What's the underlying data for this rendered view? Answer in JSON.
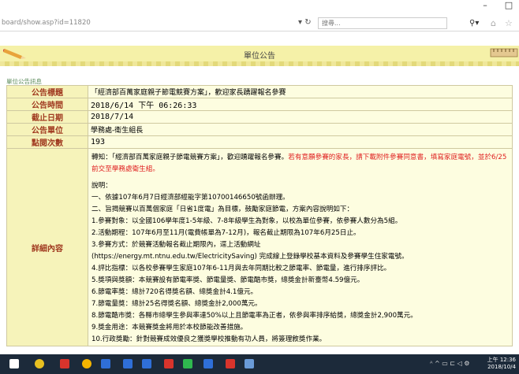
{
  "browser": {
    "url": "board/show.asp?id=11820",
    "search_placeholder": "搜尋...",
    "window_controls": [
      "–",
      "□"
    ]
  },
  "banner": {
    "title": "單位公告"
  },
  "section_label": "單位公告訊息",
  "rows": [
    {
      "label": "公告標題",
      "value": "「經濟部百萬家庭親子節電競賽方案」，歡迎家長踴躍報名參賽"
    },
    {
      "label": "公告時間",
      "value": "2018/6/14 下午 06:26:33"
    },
    {
      "label": "截止日期",
      "value": "2018/7/14"
    },
    {
      "label": "公告單位",
      "value": "學務處-衛生組長"
    },
    {
      "label": "點閱次數",
      "value": "193"
    }
  ],
  "detail": {
    "label": "詳細內容",
    "intro_black": "轉知：「經濟部百萬家庭親子節電競賽方案」，歡迎踴躍報名參賽。",
    "intro_red": "若有意願參賽的家長，請下載附件參賽同意書，填寫家庭電號，並於6/25前交至學務處衛生組。",
    "lines": [
      "說明：",
      "一、依據107年6月7日經濟部經能字第10700146650號函辦理。",
      "二、旨揭競賽以百萬個家庭「日省1度電」為目標，鼓勵家庭節電，方案內容說明如下：",
      "1.參賽對象：以全國106學年度1-5年級、7-8年級學生為對象，以校為單位參賽，依參賽人數分為5組。",
      "2.活動期程：107年6月至11月(電費帳單為7-12月)，報名截止期限為107年6月25日止。",
      "3.參賽方式：於競賽活動報名截止期限內，逕上活動網址",
      "(https://energy.mt.ntnu.edu.tw/ElectricitySaving) 完成線上登錄學校基本資料及參賽學生住家電號。",
      "4.評比指標：以各校參賽學生家庭107年6-11月與去年同期比較之節電率、節電量，進行排序評比。",
      "5.獎項與獎額：本競賽設有節電率獎、節電量獎、節電酷市獎，總獎金計新臺幣4.59億元。",
      "6.節電率獎：總計720名得獎名額、總獎金計4.1億元。",
      "7.節電量獎：總計25名得獎名額、總獎金計2,000萬元。",
      "8.節電酷市獎：各縣市總學生參與率達50%以上且節電率為正者，依參與率排序給獎，總獎金計2,900萬元。",
      "9.獎金用途：本競賽獎金將用於本校節能改善措施。",
      "10.行政獎勵：針對競賽成效優良之獲獎學校推動有功人員，將簽理敘獎作業。"
    ]
  },
  "taskbar": {
    "time": "上午 12:36",
    "date": "2018/10/4",
    "icon_colors": [
      "#ffffff",
      "#e8c020",
      "#d8342c",
      "#f4b400",
      "#2f6fd8",
      "#2f6fd8",
      "#2f6fd8",
      "#d8342c",
      "#2fb84f",
      "#2f6fd8",
      "#d8342c",
      "#6a9bd8"
    ]
  }
}
